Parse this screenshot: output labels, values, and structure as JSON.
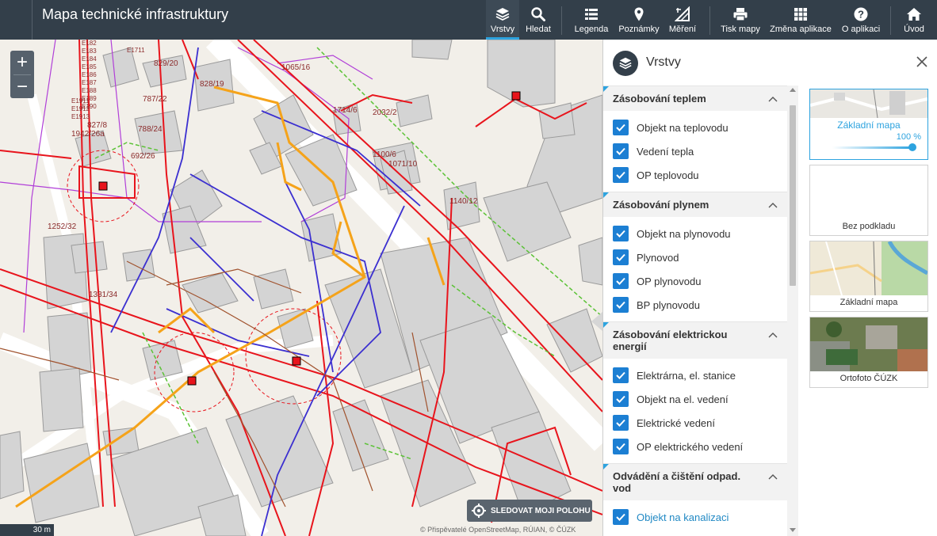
{
  "header": {
    "title": "Mapa technické infrastruktury",
    "tools": [
      {
        "label": "Vrstvy",
        "icon": "layers-icon",
        "active": true
      },
      {
        "label": "Hledat",
        "icon": "search-icon"
      },
      {
        "label": "Legenda",
        "icon": "list-icon"
      },
      {
        "label": "Poznámky",
        "icon": "pin-icon"
      },
      {
        "label": "Měření",
        "icon": "ruler-icon"
      },
      {
        "label": "Tisk mapy",
        "icon": "printer-icon"
      },
      {
        "label": "Změna aplikace",
        "icon": "grid-icon"
      },
      {
        "label": "O aplikaci",
        "icon": "help-icon"
      },
      {
        "label": "Úvod",
        "icon": "home-icon"
      }
    ]
  },
  "map": {
    "zoom_in": "+",
    "zoom_out": "−",
    "follow_label": "SLEDOVAT MOJI POLOHU",
    "scale_label": "30 m",
    "attribution": "© Přispěvatelé OpenStreetMap, RÚIAN, © ČÚZK",
    "parcel_labels": [
      "829/20",
      "828/19",
      "787/22",
      "788/24",
      "692/26",
      "827/8",
      "1942/26a",
      "1065/16",
      "1714/6",
      "2032/2",
      "1100/6",
      "1071/10",
      "1140/12",
      "1252/32",
      "1331/34",
      "E182",
      "E183",
      "E184",
      "E185",
      "E186",
      "E187",
      "E188",
      "E189",
      "E190",
      "E1911",
      "E1912",
      "E1913",
      "E1711"
    ],
    "colors": {
      "heat": "#e8141c",
      "gas": "#f5a31a",
      "electric": "#3b2fd0",
      "water": "#5bc236",
      "sewer": "#a0522d",
      "boundary": "#b13fd8",
      "building": "#d9d9d9"
    }
  },
  "panel": {
    "title": "Vrstvy",
    "groups": [
      {
        "title": "Zásobování teplem",
        "items": [
          "Objekt na teplovodu",
          "Vedení tepla",
          "OP teplovodu"
        ]
      },
      {
        "title": "Zásobování plynem",
        "items": [
          "Objekt na plynovodu",
          "Plynovod",
          "OP plynovodu",
          "BP plynovodu"
        ]
      },
      {
        "title": "Zásobování elektrickou energií",
        "items": [
          "Elektrárna, el. stanice",
          "Objekt na el. vedení",
          "Elektrické vedení",
          "OP elektrického vedení"
        ]
      },
      {
        "title": "Odvádění a čištění odpad. vod",
        "items": [
          "Objekt na kanalizaci"
        ]
      }
    ],
    "basemaps": [
      {
        "name": "Základní mapa",
        "selected": true,
        "opacity": "100 %"
      },
      {
        "name": "Bez podkladu"
      },
      {
        "name": "Základní mapa"
      },
      {
        "name": "Ortofoto ČÚZK"
      }
    ]
  }
}
